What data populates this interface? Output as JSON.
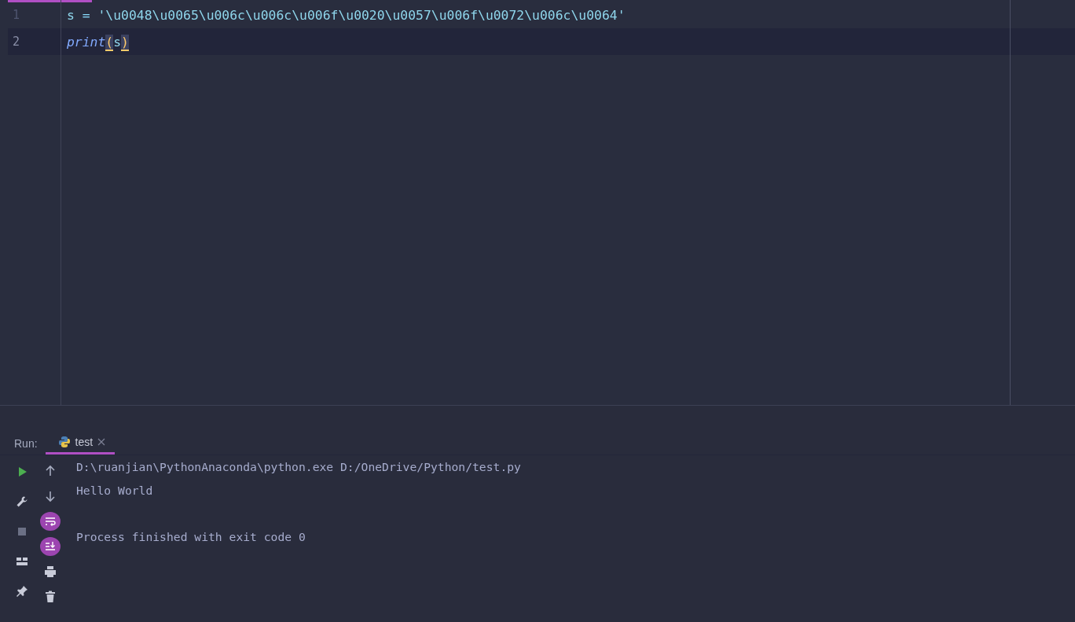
{
  "editor": {
    "lines": [
      {
        "number": "1",
        "current": false,
        "tokens": [
          {
            "text": "s",
            "kind": "ident"
          },
          {
            "text": " = ",
            "kind": "op"
          },
          {
            "text": "'\\u0048\\u0065\\u006c\\u006c\\u006f\\u0020\\u0057\\u006f\\u0072\\u006c\\u0064'",
            "kind": "string"
          }
        ]
      },
      {
        "number": "2",
        "current": true,
        "tokens": [
          {
            "text": "print",
            "kind": "builtin"
          },
          {
            "text": "(",
            "kind": "bracket-match"
          },
          {
            "text": "s",
            "kind": "ident"
          },
          {
            "text": ")",
            "kind": "bracket-match"
          }
        ]
      }
    ]
  },
  "run_panel": {
    "label": "Run:",
    "tabs": [
      {
        "label": "test",
        "selected": true
      }
    ],
    "tools_left": [
      {
        "kind": "run",
        "on": false
      },
      {
        "kind": "wrench",
        "on": false
      },
      {
        "kind": "stop",
        "on": false
      },
      {
        "kind": "layout",
        "on": false
      },
      {
        "kind": "pin",
        "on": false
      }
    ],
    "tools_right": [
      {
        "kind": "up",
        "on": false
      },
      {
        "kind": "down",
        "on": false
      },
      {
        "kind": "wrap",
        "on": true
      },
      {
        "kind": "scroll-end",
        "on": true
      },
      {
        "kind": "print",
        "on": false
      },
      {
        "kind": "trash",
        "on": false
      }
    ],
    "output": [
      {
        "text": "D:\\ruanjian\\PythonAnaconda\\python.exe D:/OneDrive/Python/test.py",
        "blank_before": false
      },
      {
        "text": "Hello World",
        "blank_before": false
      },
      {
        "text": "Process finished with exit code 0",
        "blank_before": true
      }
    ]
  }
}
